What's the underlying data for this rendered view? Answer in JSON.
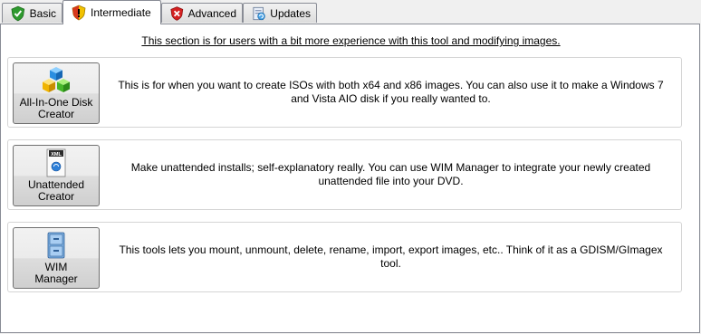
{
  "tabs": [
    {
      "label": "Basic",
      "icon": "shield-check-icon",
      "active": false
    },
    {
      "label": "Intermediate",
      "icon": "shield-warning-icon",
      "active": true
    },
    {
      "label": "Advanced",
      "icon": "shield-error-icon",
      "active": false
    },
    {
      "label": "Updates",
      "icon": "updates-icon",
      "active": false
    }
  ],
  "header": "This section is for users with a bit more experience with this tool and modifying images.",
  "tools": [
    {
      "button_label": "All-In-One Disk\nCreator",
      "icon": "cubes-icon",
      "description": "This is for when you want to create ISOs with both x64 and x86 images. You can also use it to make a Windows 7 and Vista AIO disk if you really wanted to."
    },
    {
      "button_label": "Unattended\nCreator",
      "icon": "xml-file-icon",
      "icon_text": "XML",
      "description": "Make unattended installs; self-explanatory really. You can use WIM Manager to integrate your newly created unattended file into your DVD."
    },
    {
      "button_label": "WIM\nManager",
      "icon": "cabinet-icon",
      "description": "This tools lets you mount, unmount, delete, rename, import, export images, etc.. Think of it as a GDISM/GImagex tool."
    }
  ],
  "colors": {
    "tab_border": "#898c95",
    "group_border": "#d5d5d5",
    "shield_green": "#2e9a2e",
    "shield_yellow": "#f2c200",
    "shield_red": "#d42020"
  }
}
